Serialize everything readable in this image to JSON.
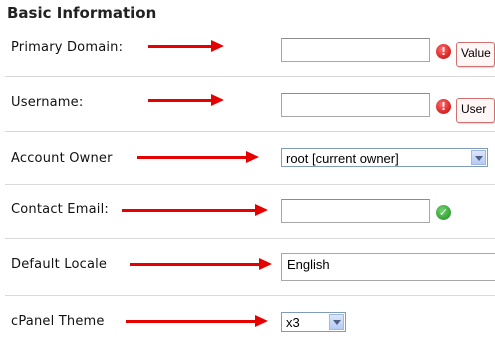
{
  "section_title": "Basic Information",
  "rows": {
    "primary_domain": {
      "label": "Primary Domain:",
      "value": "",
      "tooltip": "Value"
    },
    "username": {
      "label": "Username:",
      "value": "",
      "tooltip": "User"
    },
    "account_owner": {
      "label": "Account Owner",
      "selected": "root [current owner]"
    },
    "contact_email": {
      "label": "Contact Email:",
      "value": ""
    },
    "default_locale": {
      "label": "Default Locale",
      "value": "English"
    },
    "cpanel_theme": {
      "label": "cPanel Theme",
      "selected": "x3"
    }
  },
  "icons": {
    "error": "!",
    "success": "✓"
  },
  "colors": {
    "arrow": "#e60000",
    "error": "#c40000",
    "success": "#1e8a1e"
  }
}
